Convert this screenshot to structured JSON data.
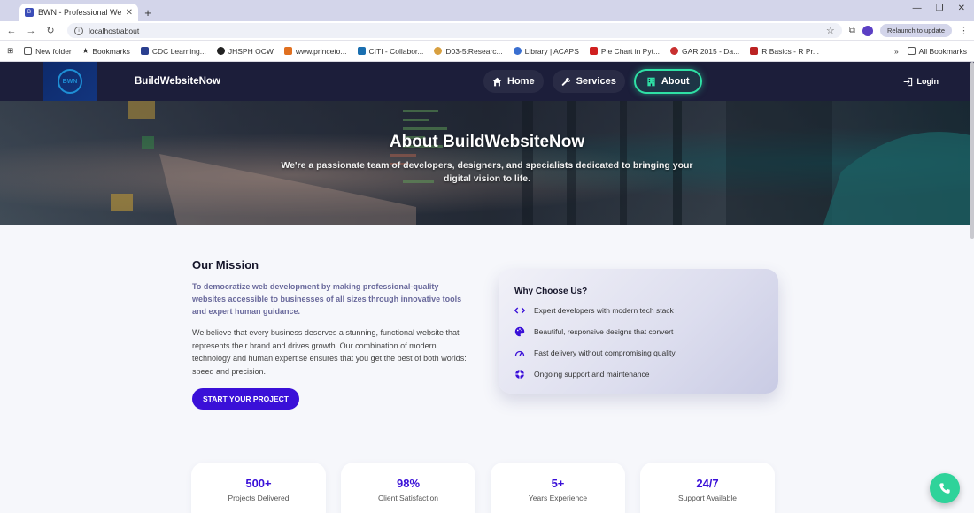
{
  "browser": {
    "tab_title": "BWN - Professional Web",
    "url": "localhost/about",
    "relaunch_label": "Relaunch to update",
    "bookmarks": [
      "New folder",
      "Bookmarks",
      "CDC Learning...",
      "JHSPH OCW",
      "www.princeto...",
      "CITI - Collabor...",
      "D03-5:Researc...",
      "Library | ACAPS",
      "Pie Chart in Pyt...",
      "GAR 2015 - Da...",
      "R Basics - R Pr..."
    ],
    "all_bookmarks_label": "All Bookmarks"
  },
  "header": {
    "brand": "BuildWebsiteNow",
    "nav": [
      {
        "label": "Home",
        "icon": "home-icon"
      },
      {
        "label": "Services",
        "icon": "wrench-icon"
      },
      {
        "label": "About",
        "icon": "building-icon"
      }
    ],
    "active_nav": "About",
    "login_label": "Login"
  },
  "hero": {
    "title": "About BuildWebsiteNow",
    "subtitle": "We're a passionate team of developers, designers, and specialists dedicated to bringing your digital vision to life."
  },
  "mission": {
    "heading": "Our Mission",
    "lead": "To democratize web development by making professional-quality websites accessible to businesses of all sizes through innovative tools and expert human guidance.",
    "body": "We believe that every business deserves a stunning, functional website that represents their brand and drives growth. Our combination of modern technology and human expertise ensures that you get the best of both worlds: speed and precision.",
    "cta_label": "START YOUR PROJECT"
  },
  "why": {
    "heading": "Why Choose Us?",
    "items": [
      {
        "icon": "code-icon",
        "text": "Expert developers with modern tech stack"
      },
      {
        "icon": "palette-icon",
        "text": "Beautiful, responsive designs that convert"
      },
      {
        "icon": "speedometer-icon",
        "text": "Fast delivery without compromising quality"
      },
      {
        "icon": "support-icon",
        "text": "Ongoing support and maintenance"
      }
    ]
  },
  "stats": [
    {
      "value": "500+",
      "label": "Projects Delivered"
    },
    {
      "value": "98%",
      "label": "Client Satisfaction"
    },
    {
      "value": "5+",
      "label": "Years Experience"
    },
    {
      "value": "24/7",
      "label": "Support Available"
    }
  ],
  "colors": {
    "accent": "#3a10d8",
    "nav_active": "#2fe0a5",
    "header_bg": "#1c1e3a",
    "fab": "#2fd39a"
  }
}
